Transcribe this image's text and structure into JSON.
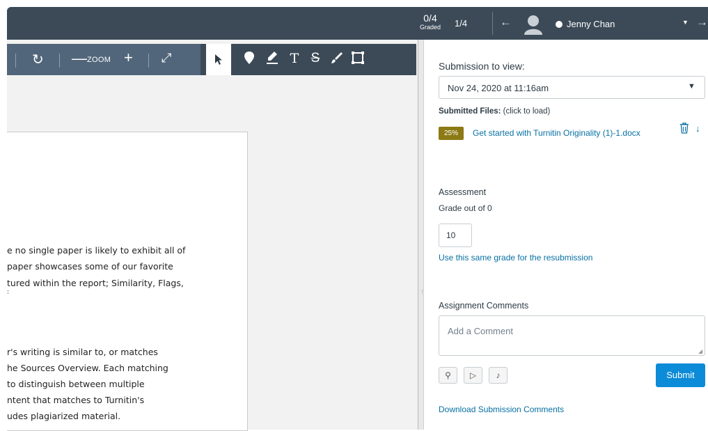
{
  "header": {
    "graded_count": "0/4",
    "graded_label": "Graded",
    "student_index": "1/4",
    "prev_icon": "arrow-left-icon",
    "next_icon": "arrow-right-icon",
    "student_name": "Jenny Chan",
    "background": "#3c4a58"
  },
  "toolbar": {
    "zoom_label": "ZOOM",
    "zoom_out": "—",
    "zoom_in": "+",
    "icons": [
      "rotate-icon",
      "fullscreen-icon",
      "select-pointer-icon",
      "pin-comment-icon",
      "highlight-pen-icon",
      "text-tool-icon",
      "strikethrough-icon",
      "freehand-draw-icon",
      "area-box-icon"
    ]
  },
  "document": {
    "lines": [
      "e no single paper is likely to exhibit all of",
      " paper showcases some of our favorite",
      "tured within the report; Similarity, Flags,",
      ":",
      "r's writing is similar to, or matches",
      "he Sources Overview. Each matching",
      " to distinguish between multiple",
      "ntent that matches to Turnitin's",
      "udes plagiarized material."
    ]
  },
  "panel": {
    "submission_heading": "Submission to view:",
    "submission_value": "Nov 24, 2020 at 11:16am",
    "files_label_bold": "Submitted Files:",
    "files_label_rest": " (click to load)",
    "similarity_score": "25%",
    "similarity_color": "#8c7a14",
    "file_name": "Get started with Turnitin Originality (1)-1.docx",
    "assessment_heading": "Assessment",
    "grade_out_of": "Grade out of 0",
    "grade_value": "10",
    "same_grade_link": "Use this same grade for the resubmission",
    "comments_heading": "Assignment Comments",
    "comment_placeholder": "Add a Comment",
    "submit_label": "Submit",
    "download_comments_link": "Download Submission Comments",
    "accent": "#0b8bd8",
    "link_color": "#0770a3"
  }
}
